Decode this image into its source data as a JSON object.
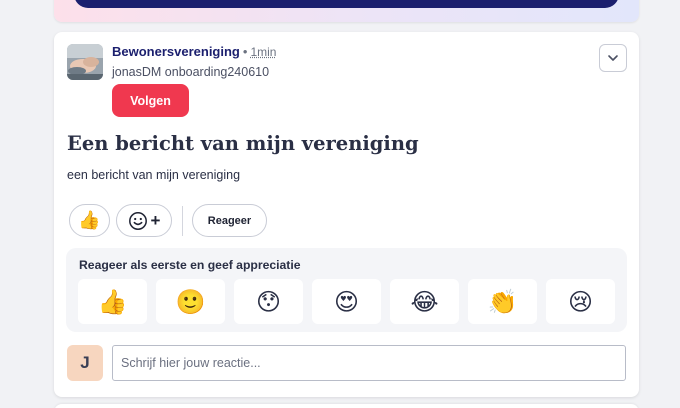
{
  "post": {
    "author": "Bewonersvereniging",
    "separator": "•",
    "time": "1min",
    "subtitle": "jonasDM onboarding240610",
    "follow_label": "Volgen",
    "title": "Een bericht van mijn vereniging",
    "body": "een bericht van mijn vereniging"
  },
  "actions": {
    "like_icon": "thumbs-up-icon",
    "add_reaction_plus": "+",
    "reply_label": "Reageer"
  },
  "reactions_panel": {
    "title": "Reageer als eerste en geef appreciatie",
    "emojis": [
      {
        "name": "thumbs-up",
        "glyph": "👍"
      },
      {
        "name": "smile",
        "glyph": "🙂"
      },
      {
        "name": "surprised",
        "glyph": "😯"
      },
      {
        "name": "heart-eyes",
        "glyph": "😍"
      },
      {
        "name": "tears-of-joy",
        "glyph": "😂"
      },
      {
        "name": "clapping",
        "glyph": "👏"
      },
      {
        "name": "crying",
        "glyph": "😢"
      }
    ]
  },
  "comment": {
    "avatar_initial": "J",
    "placeholder": "Schrijf hier jouw reactie..."
  },
  "colors": {
    "brand_navy": "#1b1f6e",
    "follow_red": "#f0384f",
    "avatar_peach": "#f7d6bf"
  }
}
